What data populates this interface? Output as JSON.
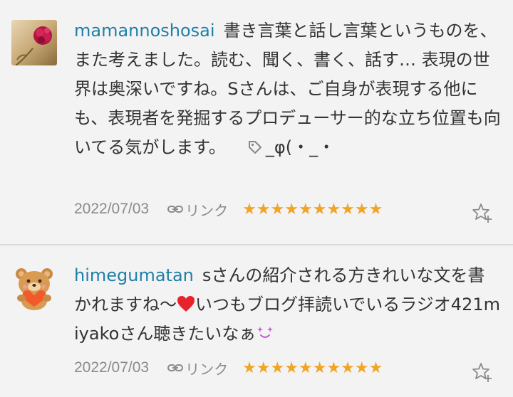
{
  "comments": [
    {
      "username": "mamannoshosai",
      "text": "書き言葉と話し言葉というものを、また考えました。読む、聞く、書く、話す… 表現の世界は奥深いですね。Sさんは、ご自身が表現する他にも、表現者を発掘するプロデューサー的な立ち位置も向いてる気がします。",
      "kaomoji": "_φ(・_・",
      "date": "2022/07/03",
      "link_label": "リンク",
      "stars": "★★★★★★★★★★",
      "avatar_icon": "carnation-flower-avatar",
      "favorite_icon": "star-plus-icon"
    },
    {
      "username": "himegumatan",
      "text_before": "sさんの紹介される方きれいな文を書かれますね〜",
      "text_middle": "いつもブログ拝読いでいるラジオ421miyakoさん聴きたいなぁ",
      "date": "2022/07/03",
      "link_label": "リンク",
      "stars": "★★★★★★★★★★",
      "avatar_icon": "bear-holding-heart-avatar",
      "favorite_icon": "star-plus-icon"
    }
  ],
  "colors": {
    "username": "#1f7fa8",
    "star": "#f2a425",
    "meta": "#8a8a8a",
    "heart": "#e8232b",
    "sparkle": "#c45bd8"
  }
}
